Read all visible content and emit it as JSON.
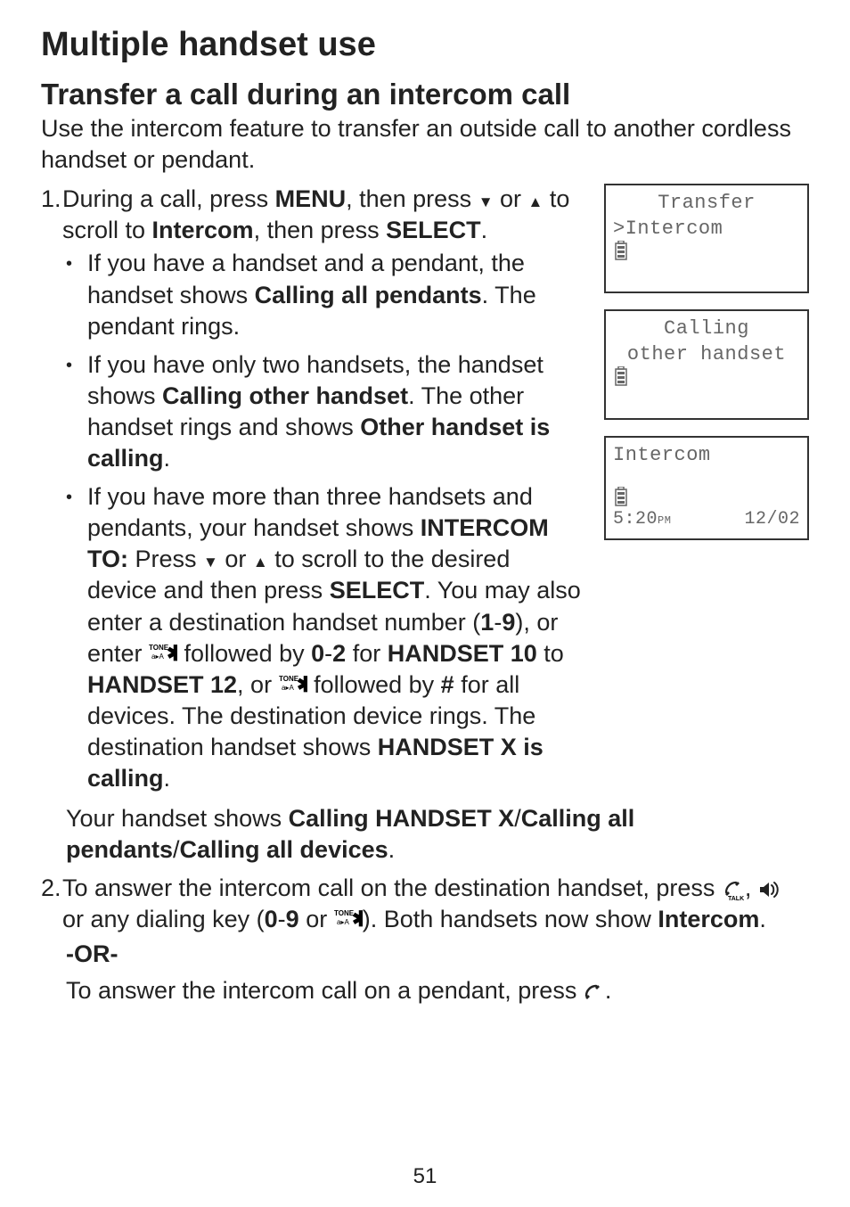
{
  "page_number": "51",
  "h1": "Multiple handset use",
  "h2": "Transfer a call during an intercom call",
  "intro": "Use the intercom feature to transfer an outside call to another cordless handset or pendant.",
  "step1": {
    "num": "1.",
    "pre": "During a call, press ",
    "menu": "MENU",
    "mid1": ", then press ",
    "mid2": " or ",
    "mid3": " to scroll to ",
    "intercom": "Intercom",
    "mid4": ", then press ",
    "select": "SELECT",
    "end": "."
  },
  "b1": {
    "a": "If you have a handset and a pendant, the handset shows ",
    "b": "Calling all pendants",
    "c": ". The pendant rings."
  },
  "b2": {
    "a": "If you have only two handsets, the handset shows ",
    "b": "Calling other handset",
    "c": ". The other handset rings and shows ",
    "d": "Other handset is calling",
    "e": "."
  },
  "b3": {
    "a": "If you have more than three handsets and pendants, your handset shows ",
    "b": "INTERCOM TO:",
    "c": " Press ",
    "d": " or ",
    "e": " to scroll to the desired device and then press ",
    "select": "SELECT",
    "f": ". You may also enter a destination handset number (",
    "g": "1",
    "h": "-",
    "i": "9",
    "j": "), or enter ",
    "k": " followed by ",
    "l": "0",
    "m": "-",
    "n": "2",
    "o": " for ",
    "p": "HANDSET 10",
    "q": " to ",
    "r": "HANDSET 12",
    "s": ", or ",
    "t": " followed by ",
    "u": "#",
    "v": " for all devices. The destination device rings. The destination handset shows ",
    "w": "HANDSET X is calling",
    "x": "."
  },
  "summary": {
    "a": "Your handset shows ",
    "b": "Calling HANDSET X",
    "c": "/",
    "d": "Calling all pendants",
    "e": "/",
    "f": "Calling all devices",
    "g": "."
  },
  "step2": {
    "num": "2.",
    "a": "To answer the intercom call on the destination handset, press ",
    "b": ", ",
    "c": " or any dialing key (",
    "d": "0",
    "e": "-",
    "f": "9",
    "g": " or ",
    "h": "). Both handsets now show ",
    "i": "Intercom",
    "j": "."
  },
  "or": "-OR-",
  "pendant": {
    "a": "To answer the intercom call on a pendant, press ",
    "b": "."
  },
  "lcd1": {
    "line1": "Transfer",
    "line2": ">Intercom"
  },
  "lcd2": {
    "line1": "Calling",
    "line2": "other handset"
  },
  "lcd3": {
    "line1": "Intercom",
    "time": "5:20",
    "ampm": "PM",
    "date": "12/02"
  }
}
